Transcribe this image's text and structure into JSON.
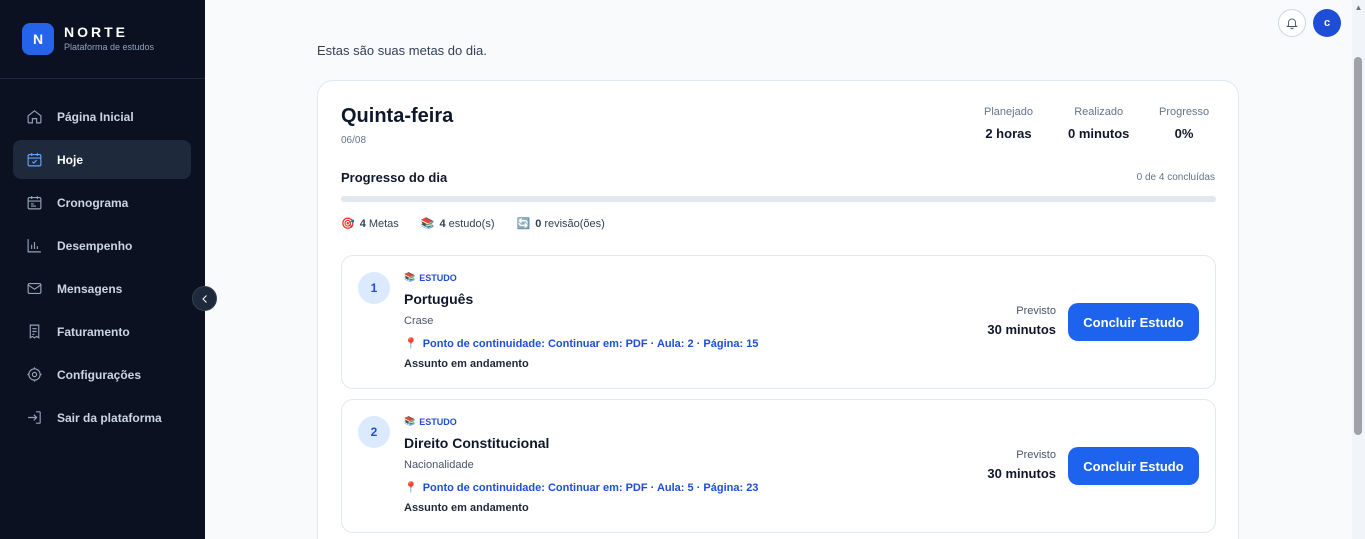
{
  "brand": {
    "logo_letter": "N",
    "name": "NORTE",
    "subtitle": "Plataforma de estudos"
  },
  "sidebar": {
    "items": [
      {
        "label": "Página Inicial",
        "icon": "home-icon",
        "active": false
      },
      {
        "label": "Hoje",
        "icon": "calendar-check-icon",
        "active": true
      },
      {
        "label": "Cronograma",
        "icon": "calendar-icon",
        "active": false
      },
      {
        "label": "Desempenho",
        "icon": "bar-chart-icon",
        "active": false
      },
      {
        "label": "Mensagens",
        "icon": "mail-icon",
        "active": false
      },
      {
        "label": "Faturamento",
        "icon": "receipt-icon",
        "active": false
      },
      {
        "label": "Configurações",
        "icon": "gear-icon",
        "active": false
      },
      {
        "label": "Sair da plataforma",
        "icon": "logout-icon",
        "active": false
      }
    ]
  },
  "header": {
    "avatar_letter": "c"
  },
  "greeting": "Estas são suas metas do dia.",
  "day": {
    "title": "Quinta-feira",
    "date": "06/08",
    "stats": {
      "planned_label": "Planejado",
      "planned_value": "2 horas",
      "done_label": "Realizado",
      "done_value": "0 minutos",
      "progress_label": "Progresso",
      "progress_value": "0%"
    },
    "progress_title": "Progresso do dia",
    "progress_count": "0 de 4 concluídas",
    "progress_fraction": 0,
    "summary": {
      "goals_count": "4",
      "goals_label": "Metas",
      "study_count": "4",
      "study_label": "estudo(s)",
      "review_count": "0",
      "review_label": "revisão(ões)"
    }
  },
  "goals": [
    {
      "number": "1",
      "type": "ESTUDO",
      "subject": "Português",
      "topic": "Crase",
      "continue": "Ponto de continuidade: Continuar em: PDF · Aula: 2 · Página: 15",
      "status": "Assunto em andamento",
      "estimate_label": "Previsto",
      "estimate_value": "30 minutos",
      "button": "Concluir Estudo"
    },
    {
      "number": "2",
      "type": "ESTUDO",
      "subject": "Direito Constitucional",
      "topic": "Nacionalidade",
      "continue": "Ponto de continuidade: Continuar em: PDF · Aula: 5 · Página: 23",
      "status": "Assunto em andamento",
      "estimate_label": "Previsto",
      "estimate_value": "30 minutos",
      "button": "Concluir Estudo"
    }
  ],
  "colors": {
    "sidebar_bg": "#0b1120",
    "accent": "#1d63ed",
    "link": "#1d4ed8"
  }
}
